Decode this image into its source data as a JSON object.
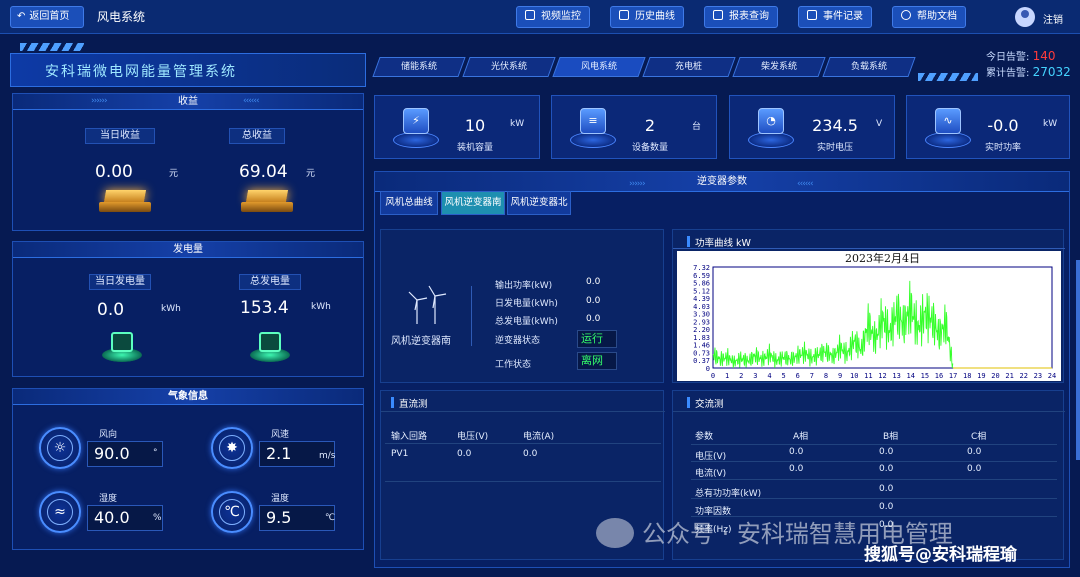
{
  "topbar": {
    "back_label": "返回首页",
    "system_name": "风电系统",
    "buttons": [
      "视频监控",
      "历史曲线",
      "报表查询",
      "事件记录",
      "帮助文档"
    ],
    "logout_label": "注销"
  },
  "header": {
    "title": "安科瑞微电网能量管理系统",
    "tabs": [
      "储能系统",
      "光伏系统",
      "风电系统",
      "充电桩",
      "柴发系统",
      "负载系统"
    ],
    "alarm_today_label": "今日告警:",
    "alarm_today_value": "140",
    "alarm_total_label": "累计告警:",
    "alarm_total_value": "27032"
  },
  "income": {
    "title": "收益",
    "today_label": "当日收益",
    "today_value": "0.00",
    "today_unit": "元",
    "total_label": "总收益",
    "total_value": "69.04",
    "total_unit": "元"
  },
  "generation": {
    "title": "发电量",
    "today_label": "当日发电量",
    "today_value": "0.0",
    "today_unit": "kWh",
    "total_label": "总发电量",
    "total_value": "153.4",
    "total_unit": "kWh"
  },
  "weather": {
    "title": "气象信息",
    "wind_dir_label": "风向",
    "wind_dir_value": "90.0",
    "wind_dir_unit": "°",
    "wind_speed_label": "风速",
    "wind_speed_value": "2.1",
    "wind_speed_unit": "m/s",
    "humidity_label": "湿度",
    "humidity_value": "40.0",
    "humidity_unit": "%",
    "temp_label": "温度",
    "temp_value": "9.5",
    "temp_unit": "℃"
  },
  "kpis": [
    {
      "value": "10",
      "unit": "kW",
      "name": "装机容量",
      "icon": "lightning-icon"
    },
    {
      "value": "2",
      "unit": "台",
      "name": "设备数量",
      "icon": "device-icon"
    },
    {
      "value": "234.5",
      "unit": "V",
      "name": "实时电压",
      "icon": "gauge-icon"
    },
    {
      "value": "-0.0",
      "unit": "kW",
      "name": "实时功率",
      "icon": "pulse-icon"
    }
  ],
  "inverter": {
    "title": "逆变器参数",
    "subtabs": [
      "风机总曲线",
      "风机逆变器南",
      "风机逆变器北"
    ],
    "active_subtab": 1,
    "device_name": "风机逆变器南",
    "output_power_label": "输出功率(kW)",
    "output_power_value": "0.0",
    "daily_energy_label": "日发电量(kWh)",
    "daily_energy_value": "0.0",
    "total_energy_label": "总发电量(kWh)",
    "total_energy_value": "0.0",
    "status_label": "逆变器状态",
    "status_value": "运行",
    "work_label": "工作状态",
    "work_value": "离网"
  },
  "chart_panel": {
    "title": "功率曲线",
    "unit": "kW"
  },
  "chart_data": {
    "type": "line",
    "title": "2023年2月4日",
    "xlabel": "",
    "ylabel": "",
    "x_ticks": [
      0,
      1,
      2,
      3,
      4,
      5,
      6,
      7,
      8,
      9,
      10,
      11,
      12,
      13,
      14,
      15,
      16,
      17,
      18,
      19,
      20,
      21,
      22,
      23,
      24
    ],
    "y_ticks": [
      "0",
      "0.37",
      "0.73",
      "1.46",
      "1.83",
      "2.20",
      "2.93",
      "3.30",
      "4.03",
      "4.39",
      "5.12",
      "5.86",
      "6.59",
      "7.32"
    ],
    "xlim": [
      0,
      24
    ],
    "ylim": [
      0,
      7.32
    ],
    "series": [
      {
        "color": "#35ff2a",
        "x": [
          0,
          0.5,
          1,
          1.5,
          2,
          2.5,
          3,
          3.5,
          4,
          4.5,
          5,
          5.5,
          6,
          6.5,
          7,
          7.5,
          8,
          8.5,
          9,
          9.5,
          10,
          10.5,
          11,
          11.5,
          12,
          12.5,
          13,
          13.5,
          14,
          14.5,
          15,
          15.5,
          16,
          16.5,
          17
        ],
        "y": [
          1.0,
          0.6,
          0.8,
          0.4,
          0.7,
          0.5,
          0.9,
          0.6,
          1.0,
          0.5,
          0.8,
          0.6,
          0.9,
          1.1,
          0.7,
          1.0,
          1.2,
          0.8,
          1.5,
          1.0,
          2.0,
          1.3,
          3.2,
          2.0,
          3.6,
          2.5,
          4.0,
          3.1,
          4.4,
          2.8,
          3.9,
          3.5,
          2.4,
          3.2,
          0.0
        ]
      }
    ]
  },
  "dc": {
    "title": "直流测",
    "headers": [
      "输入回路",
      "电压(V)",
      "电流(A)"
    ],
    "rows": [
      [
        "PV1",
        "0.0",
        "0.0"
      ]
    ]
  },
  "ac": {
    "title": "交流测",
    "headers": [
      "参数",
      "A相",
      "B相",
      "C相"
    ],
    "rows": [
      [
        "电压(V)",
        "0.0",
        "0.0",
        "0.0"
      ],
      [
        "电流(V)",
        "0.0",
        "0.0",
        "0.0"
      ],
      [
        "总有功功率(kW)",
        "",
        "0.0",
        ""
      ],
      [
        "功率因数",
        "",
        "0.0",
        ""
      ],
      [
        "频率(Hz)",
        "",
        "0.0",
        ""
      ]
    ]
  },
  "watermark": {
    "text": "公众号 · 安科瑞智慧用电管理",
    "text2": "搜狐号@安科瑞程瑜"
  }
}
